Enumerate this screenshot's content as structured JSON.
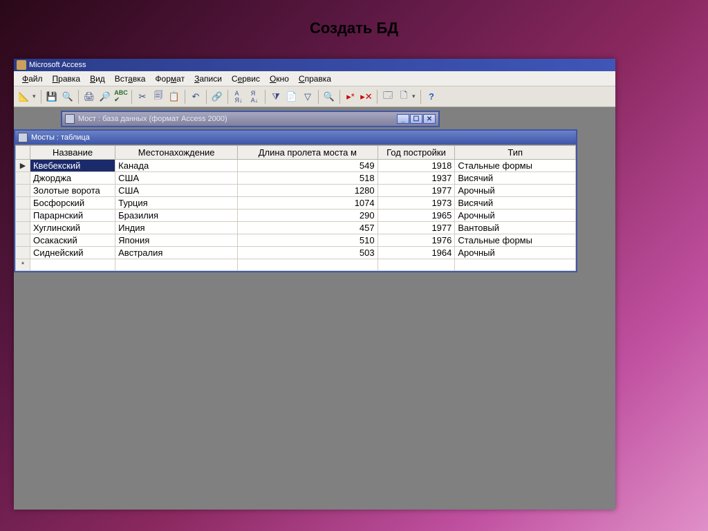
{
  "slide_title": "Создать БД",
  "app": {
    "title": "Microsoft Access"
  },
  "menu": {
    "file": "Файл",
    "edit": "Правка",
    "view": "Вид",
    "insert": "Вставка",
    "format": "Формат",
    "records": "Записи",
    "service": "Сервис",
    "window": "Окно",
    "help": "Справка"
  },
  "db_window": {
    "title": "Мост : база данных (формат Access 2000)"
  },
  "table_window": {
    "title": "Мосты : таблица"
  },
  "columns": {
    "name": "Название",
    "location": "Местонахождение",
    "length": "Длина пролета моста м",
    "year": "Год постройки",
    "type": "Тип"
  },
  "rows": [
    {
      "name": "Квебекский",
      "loc": "Канада",
      "len": "549",
      "year": "1918",
      "type": "Стальные формы"
    },
    {
      "name": "Джорджа",
      "loc": "США",
      "len": "518",
      "year": "1937",
      "type": "Висячий"
    },
    {
      "name": "Золотые ворота",
      "loc": "США",
      "len": "1280",
      "year": "1977",
      "type": "Арочный"
    },
    {
      "name": "Босфорский",
      "loc": "Турция",
      "len": "1074",
      "year": "1973",
      "type": "Висячий"
    },
    {
      "name": "Парарнский",
      "loc": "Бразилия",
      "len": "290",
      "year": "1965",
      "type": "Арочный"
    },
    {
      "name": "Хуглинский",
      "loc": "Индия",
      "len": "457",
      "year": "1977",
      "type": "Вантовый"
    },
    {
      "name": "Осакаский",
      "loc": "Япония",
      "len": "510",
      "year": "1976",
      "type": "Стальные формы"
    },
    {
      "name": "Сиднейский",
      "loc": "Австралия",
      "len": "503",
      "year": "1964",
      "type": "Арочный"
    }
  ]
}
